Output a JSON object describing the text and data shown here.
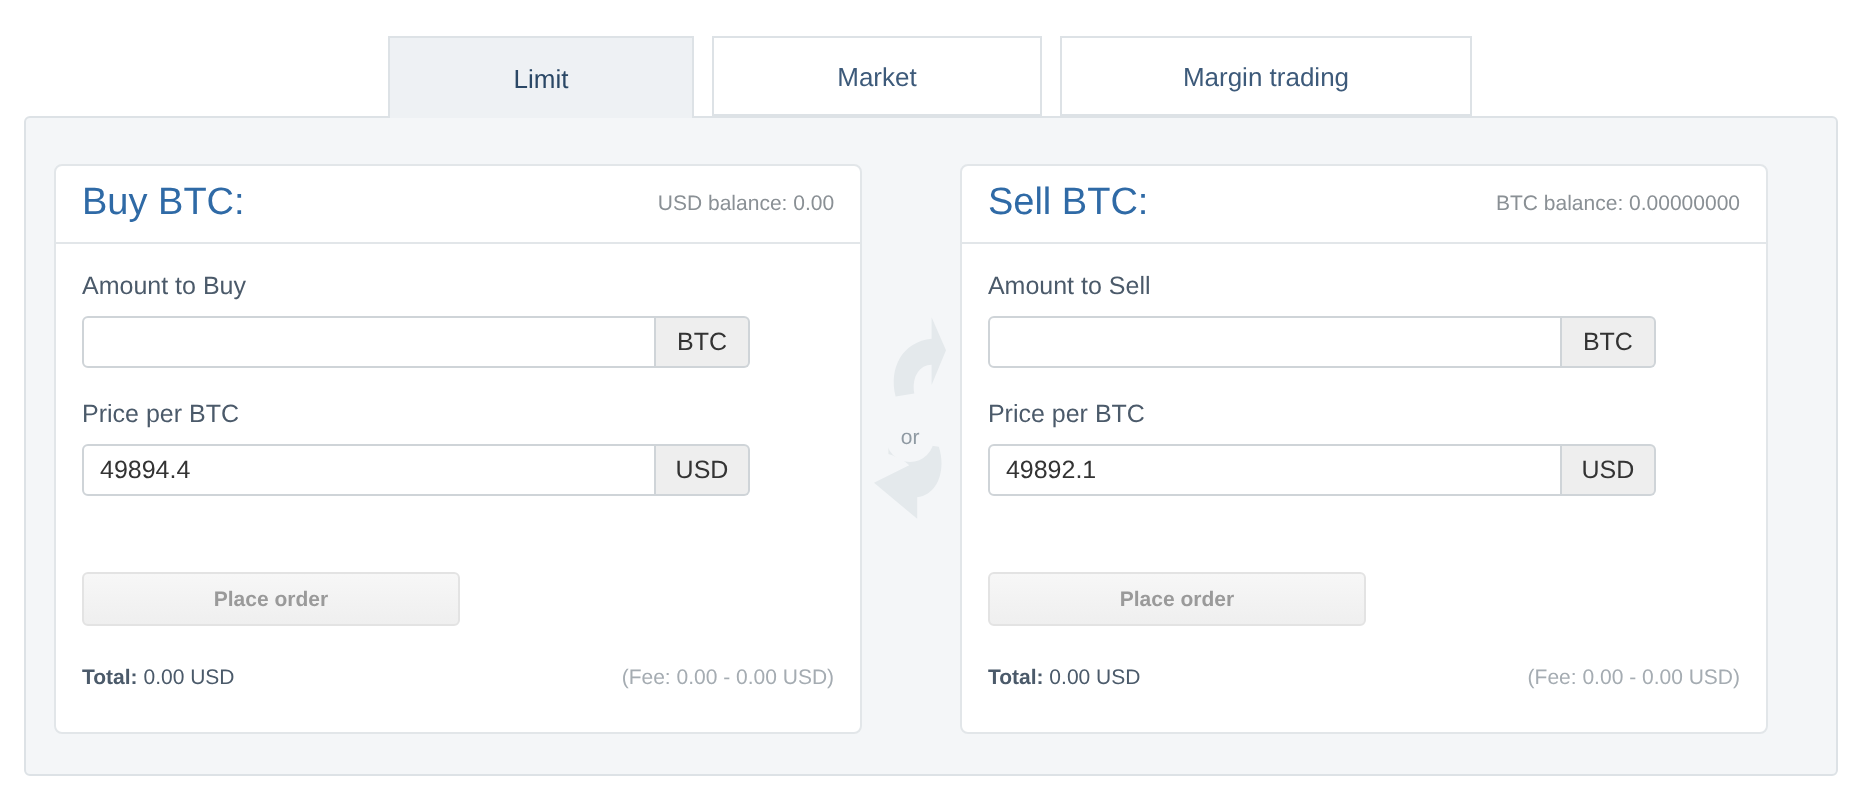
{
  "tabs": [
    {
      "label": "Limit",
      "selected": true
    },
    {
      "label": "Market",
      "selected": false
    },
    {
      "label": "Margin trading",
      "selected": false
    }
  ],
  "divider_label": "or",
  "forms": [
    {
      "title": "Buy BTC:",
      "balance": "USD balance: 0.00",
      "fields": [
        {
          "label": "Amount to Buy",
          "unit": "BTC"
        },
        {
          "label": "Price per BTC",
          "value": "49894.4",
          "unit": "USD"
        }
      ],
      "button": {
        "label": "Place order",
        "disabled": true
      },
      "total": "**Total:** 0.00 USD",
      "fee": "(Fee: 0.00 - 0.00 USD)"
    },
    {
      "title": "Sell BTC:",
      "balance": "BTC balance: 0.00000000",
      "fields": [
        {
          "label": "Amount to Sell",
          "unit": "BTC"
        },
        {
          "label": "Price per BTC",
          "value": "49892.1",
          "unit": "USD"
        }
      ],
      "button": {
        "label": "Place order",
        "disabled": true
      },
      "total": "**Total:** 0.00 USD",
      "fee": "(Fee: 0.00 - 0.00 USD)"
    }
  ]
}
